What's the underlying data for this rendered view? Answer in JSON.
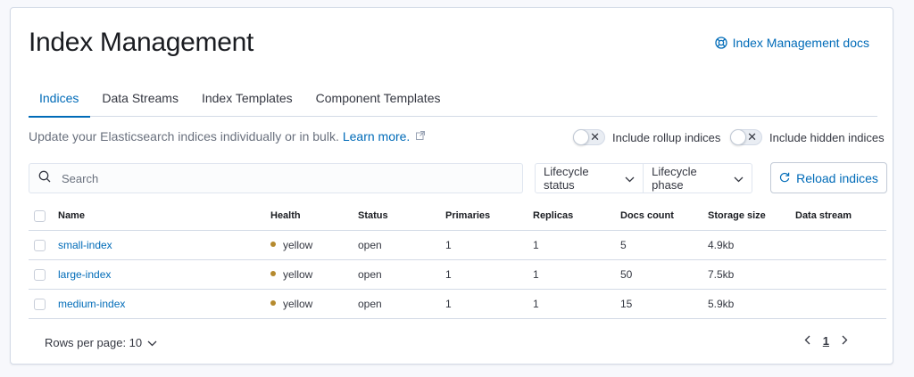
{
  "page": {
    "title": "Index Management",
    "docs_link": "Index Management docs"
  },
  "tabs": [
    {
      "label": "Indices",
      "active": true
    },
    {
      "label": "Data Streams",
      "active": false
    },
    {
      "label": "Index Templates",
      "active": false
    },
    {
      "label": "Component Templates",
      "active": false
    }
  ],
  "description": {
    "text": "Update your Elasticsearch indices individually or in bulk.",
    "learn_more": "Learn more."
  },
  "toggles": {
    "rollup": {
      "label": "Include rollup indices",
      "checked": false
    },
    "hidden": {
      "label": "Include hidden indices",
      "checked": false
    }
  },
  "search": {
    "placeholder": "Search",
    "value": ""
  },
  "filters": {
    "lifecycle_status": "Lifecycle status",
    "lifecycle_phase": "Lifecycle phase"
  },
  "reload_button": "Reload indices",
  "table": {
    "columns": [
      "Name",
      "Health",
      "Status",
      "Primaries",
      "Replicas",
      "Docs count",
      "Storage size",
      "Data stream"
    ],
    "rows": [
      {
        "name": "small-index",
        "health": "yellow",
        "status": "open",
        "primaries": "1",
        "replicas": "1",
        "docs_count": "5",
        "storage_size": "4.9kb",
        "data_stream": ""
      },
      {
        "name": "large-index",
        "health": "yellow",
        "status": "open",
        "primaries": "1",
        "replicas": "1",
        "docs_count": "50",
        "storage_size": "7.5kb",
        "data_stream": ""
      },
      {
        "name": "medium-index",
        "health": "yellow",
        "status": "open",
        "primaries": "1",
        "replicas": "1",
        "docs_count": "15",
        "storage_size": "5.9kb",
        "data_stream": ""
      }
    ]
  },
  "pagination": {
    "rows_per_page": "Rows per page: 10",
    "current_page": "1"
  },
  "colors": {
    "accent": "#006bb8",
    "health_yellow": "#b58a2e",
    "border": "#d3dae6"
  },
  "icons": {
    "docs": "lifebuoy-icon",
    "external_link": "external-link-icon",
    "search": "search-icon",
    "reload": "refresh-icon",
    "dropdown": "chevron-down-icon"
  }
}
